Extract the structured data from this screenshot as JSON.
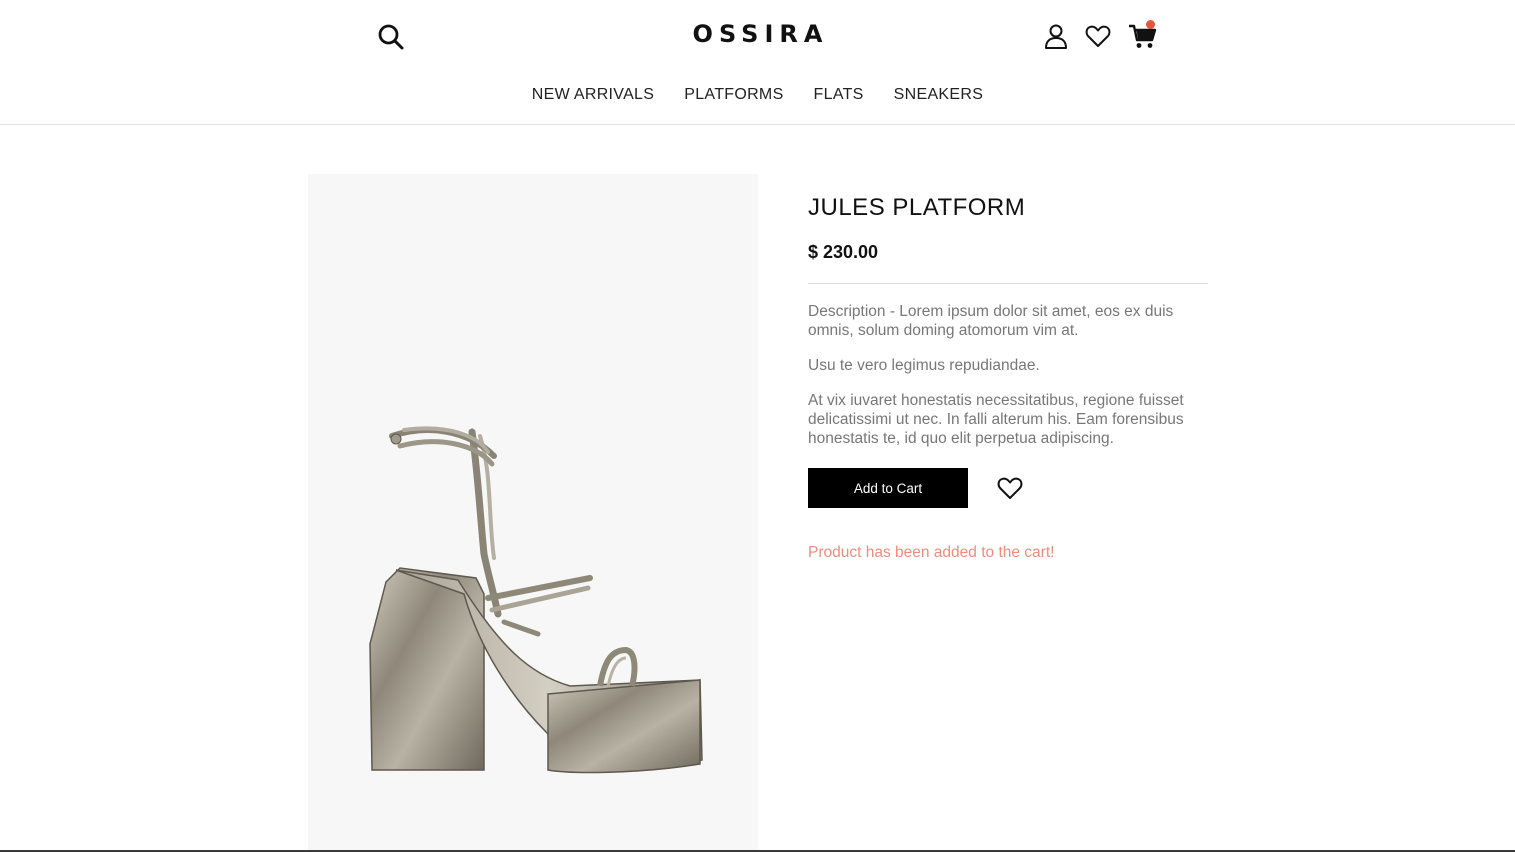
{
  "header": {
    "logo": "OSSIRA",
    "icons": {
      "search": "search-icon",
      "account": "user-icon",
      "wishlist": "heart-icon",
      "cart": "cart-icon"
    },
    "cart_badge_color": "#e2583a"
  },
  "nav": {
    "items": [
      "NEW ARRIVALS",
      "PLATFORMS",
      "FLATS",
      "SNEAKERS"
    ]
  },
  "product": {
    "title": "JULES PLATFORM",
    "price": "$ 230.00",
    "description": [
      "Description - Lorem ipsum dolor sit amet, eos ex duis omnis, solum doming atomorum vim at.",
      "Usu te vero legimus repudiandae.",
      "At vix iuvaret honestatis necessitatibus, regione fuisset delicatissimi ut nec. In falli alterum his. Eam forensibus honestatis te, id quo elit perpetua adipiscing."
    ],
    "add_to_cart_label": "Add to Cart",
    "added_message": "Product has been added to the cart!",
    "added_message_color": "#f08c7d"
  }
}
